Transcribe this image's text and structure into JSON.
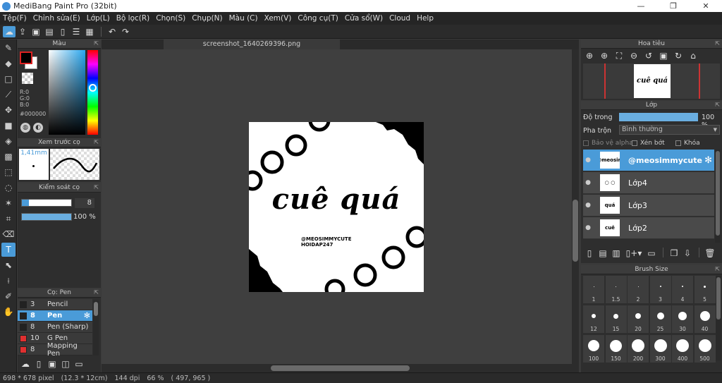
{
  "window": {
    "title": "MediBang Paint Pro (32bit)",
    "minimize": "—",
    "maximize": "❐",
    "close": "✕"
  },
  "menu": [
    "Tệp(F)",
    "Chỉnh sửa(E)",
    "Lớp(L)",
    "Bộ lọc(R)",
    "Chọn(S)",
    "Chụp(N)",
    "Màu (C)",
    "Xem(V)",
    "Công cụ(T)",
    "Cửa sổ(W)",
    "Cloud",
    "Help"
  ],
  "color_panel": {
    "title": "Màu",
    "r": "R:0",
    "g": "G:0",
    "b": "B:0",
    "hex": "#000000"
  },
  "brush_preview": {
    "title": "Xem trước cọ",
    "size": "1,41mm"
  },
  "brush_control": {
    "title": "Kiểm soát cọ",
    "size_value": "8",
    "opacity_value": "100 %",
    "opacity_fraction": 1.0
  },
  "brush_panel": {
    "title": "Cọ: Pen",
    "items": [
      {
        "size": "3",
        "name": "Pencil",
        "color": "#222222",
        "selected": false
      },
      {
        "size": "8",
        "name": "Pen",
        "color": "#222222",
        "selected": true
      },
      {
        "size": "8",
        "name": "Pen (Sharp)",
        "color": "#222222",
        "selected": false
      },
      {
        "size": "10",
        "name": "G Pen",
        "color": "#e03030",
        "selected": false
      },
      {
        "size": "8",
        "name": "Mapping Pen",
        "color": "#e03030",
        "selected": false
      }
    ]
  },
  "document": {
    "tab": "screenshot_1640269396.png",
    "text_main": "cuê quá",
    "text_line1": "@MEOSIMMYCUTE",
    "text_line2": "HOIDAP247"
  },
  "navigator": {
    "title": "Hoa tiêu"
  },
  "layer_panel": {
    "title": "Lớp",
    "opacity_label": "Độ trong",
    "opacity_value": "100 %",
    "opacity_fraction": 1.0,
    "blend_label": "Pha trộn",
    "blend_value": "Bình thường",
    "protect_alpha": "Bảo vệ alpha",
    "clipping": "Xén bớt",
    "lock": "Khóa",
    "layers": [
      {
        "name": "@meosimmycute",
        "selected": true,
        "thumb": "@meosim"
      },
      {
        "name": "Lớp4",
        "selected": false,
        "thumb": "○ ○"
      },
      {
        "name": "Lớp3",
        "selected": false,
        "thumb": "quá"
      },
      {
        "name": "Lớp2",
        "selected": false,
        "thumb": "cuê"
      }
    ]
  },
  "brush_size": {
    "title": "Brush Size",
    "sizes": [
      "1",
      "1.5",
      "2",
      "3",
      "4",
      "5",
      "12",
      "15",
      "20",
      "25",
      "30",
      "40",
      "100",
      "150",
      "200",
      "300",
      "400",
      "500"
    ]
  },
  "status": {
    "dimensions": "698 * 678 pixel",
    "physical": "(12.3 * 12cm)",
    "dpi": "144 dpi",
    "zoom": "66 %",
    "coords": "( 497, 965 )"
  },
  "colors": {
    "accent": "#4a9bd8",
    "panel": "#2e2e2e",
    "header": "#3c3c3c"
  }
}
